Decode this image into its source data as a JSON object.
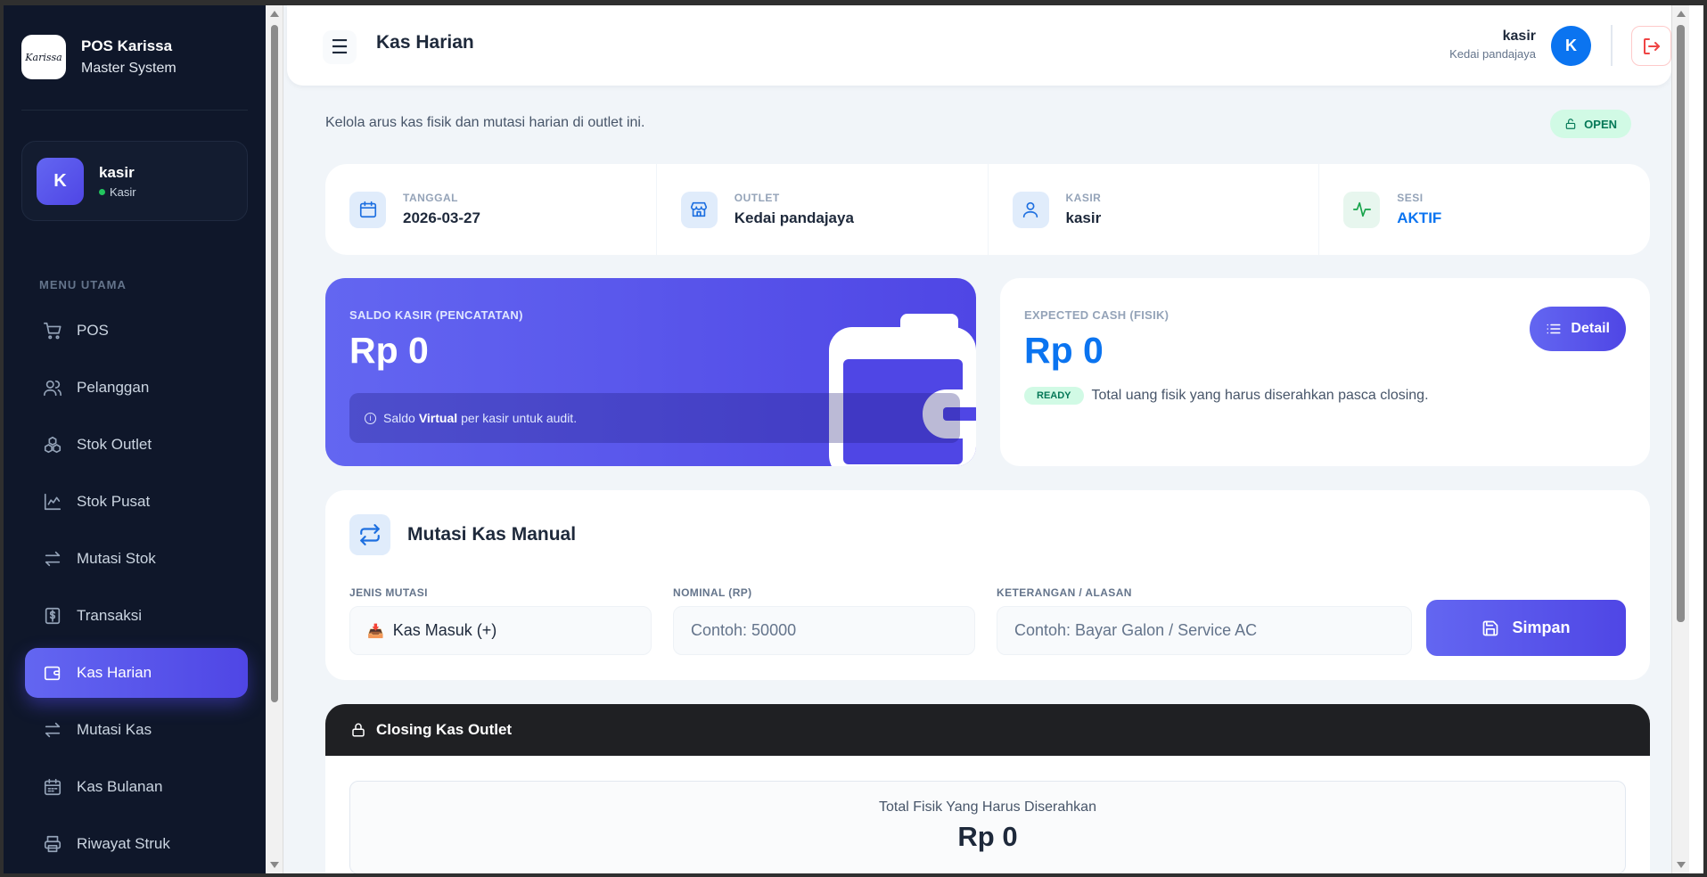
{
  "brand": {
    "logo_text": "Karissa",
    "title": "POS Karissa",
    "subtitle": "Master System"
  },
  "sidebar_user": {
    "avatar": "K",
    "name": "kasir",
    "role": "Kasir"
  },
  "menu": {
    "heading": "MENU UTAMA",
    "items": [
      {
        "label": "POS",
        "icon": "cart-icon"
      },
      {
        "label": "Pelanggan",
        "icon": "users-icon"
      },
      {
        "label": "Stok Outlet",
        "icon": "boxes-icon"
      },
      {
        "label": "Stok Pusat",
        "icon": "chart-icon"
      },
      {
        "label": "Mutasi Stok",
        "icon": "swap-icon"
      },
      {
        "label": "Transaksi",
        "icon": "receipt-dollar-icon"
      },
      {
        "label": "Kas Harian",
        "icon": "wallet-icon",
        "active": true
      },
      {
        "label": "Mutasi Kas",
        "icon": "swap-icon"
      },
      {
        "label": "Kas Bulanan",
        "icon": "calendar-icon"
      },
      {
        "label": "Riwayat Struk",
        "icon": "printer-icon"
      }
    ]
  },
  "header": {
    "title": "Kas Harian",
    "user_name": "kasir",
    "outlet_name": "Kedai pandajaya",
    "avatar": "K"
  },
  "intro": {
    "text": "Kelola arus kas fisik dan mutasi harian di outlet ini.",
    "status": "OPEN"
  },
  "info": {
    "tanggal_label": "TANGGAL",
    "tanggal_value": "2026-03-27",
    "outlet_label": "OUTLET",
    "outlet_value": "Kedai pandajaya",
    "kasir_label": "KASIR",
    "kasir_value": "kasir",
    "sesi_label": "SESI",
    "sesi_value": "AKTIF"
  },
  "saldo": {
    "label": "SALDO KASIR (PENCATATAN)",
    "value": "Rp 0",
    "note_prefix": "Saldo",
    "note_bold": "Virtual",
    "note_suffix": "per kasir untuk audit."
  },
  "expected": {
    "label": "EXPECTED CASH (FISIK)",
    "value": "Rp 0",
    "badge": "READY",
    "text": "Total uang fisik yang harus diserahkan pasca closing.",
    "detail_button": "Detail"
  },
  "mutasi": {
    "title": "Mutasi Kas Manual",
    "jenis_label": "JENIS MUTASI",
    "jenis_value": "Kas Masuk (+)",
    "jenis_emoji": "📥",
    "nominal_label": "NOMINAL (RP)",
    "nominal_placeholder": "Contoh: 50000",
    "keterangan_label": "KETERANGAN / ALASAN",
    "keterangan_placeholder": "Contoh: Bayar Galon / Service AC",
    "save_button": "Simpan"
  },
  "closing": {
    "title": "Closing Kas Outlet",
    "total_label": "Total Fisik Yang Harus Diserahkan",
    "total_value": "Rp 0"
  },
  "colors": {
    "accent": "#4f46e5",
    "primary_blue": "#0b74f0",
    "sidebar_bg": "#0f172a",
    "success": "#047857"
  }
}
